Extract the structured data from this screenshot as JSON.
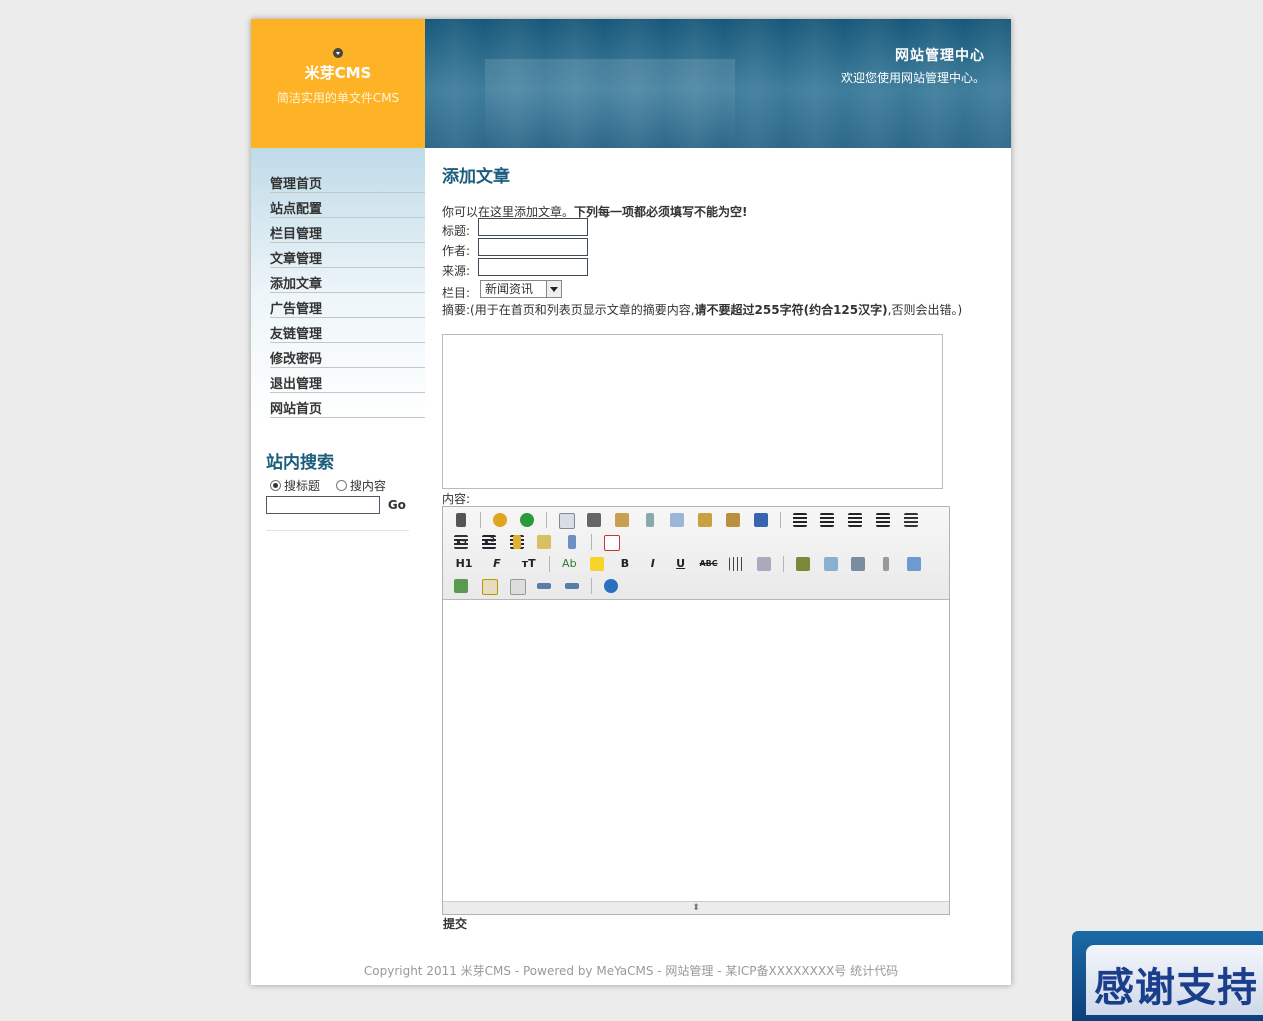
{
  "brand": {
    "name": "米芽CMS",
    "tagline": "简洁实用的单文件CMS"
  },
  "header": {
    "title": "网站管理中心",
    "welcome": "欢迎您使用网站管理中心。"
  },
  "sidebar": {
    "items": [
      {
        "label": "管理首页"
      },
      {
        "label": "站点配置"
      },
      {
        "label": "栏目管理"
      },
      {
        "label": "文章管理"
      },
      {
        "label": "添加文章"
      },
      {
        "label": "广告管理"
      },
      {
        "label": "友链管理"
      },
      {
        "label": "修改密码"
      },
      {
        "label": "退出管理"
      },
      {
        "label": "网站首页"
      }
    ]
  },
  "search": {
    "title": "站内搜索",
    "option_title": "搜标题",
    "option_content": "搜内容",
    "selected": "搜标题",
    "query": "",
    "go_label": "Go"
  },
  "main": {
    "title": "添加文章",
    "intro_normal": "你可以在这里添加文章。",
    "intro_bold": "下列每一项都必须填写不能为空!",
    "fields": {
      "title_label": "标题:",
      "author_label": "作者:",
      "source_label": "来源:",
      "category_label": "栏目:",
      "category_value": "新闻资讯"
    },
    "summary_note_a": "摘要:(用于在首页和列表页显示文章的摘要内容,",
    "summary_note_b": "请不要超过255字符(约合125汉字)",
    "summary_note_c": ",否则会出错。)",
    "content_label": "内容:",
    "submit_label": "提交"
  },
  "editor": {
    "toolbar_row3_text": {
      "heading": "H1",
      "font": "F",
      "size": "тT",
      "forecolor": "Ab",
      "bold": "B",
      "italic": "I",
      "underline": "U",
      "strike": "ABC"
    }
  },
  "footer": {
    "text": "Copyright 2011 米芽CMS - Powered by MeYaCMS - 网站管理 - 某ICP备XXXXXXXX号 统计代码"
  },
  "promo": {
    "text": "感谢支持"
  },
  "colors": {
    "accent_orange": "#fdb325",
    "header_blue": "#1b5d7d",
    "page_bg": "#ececec"
  }
}
